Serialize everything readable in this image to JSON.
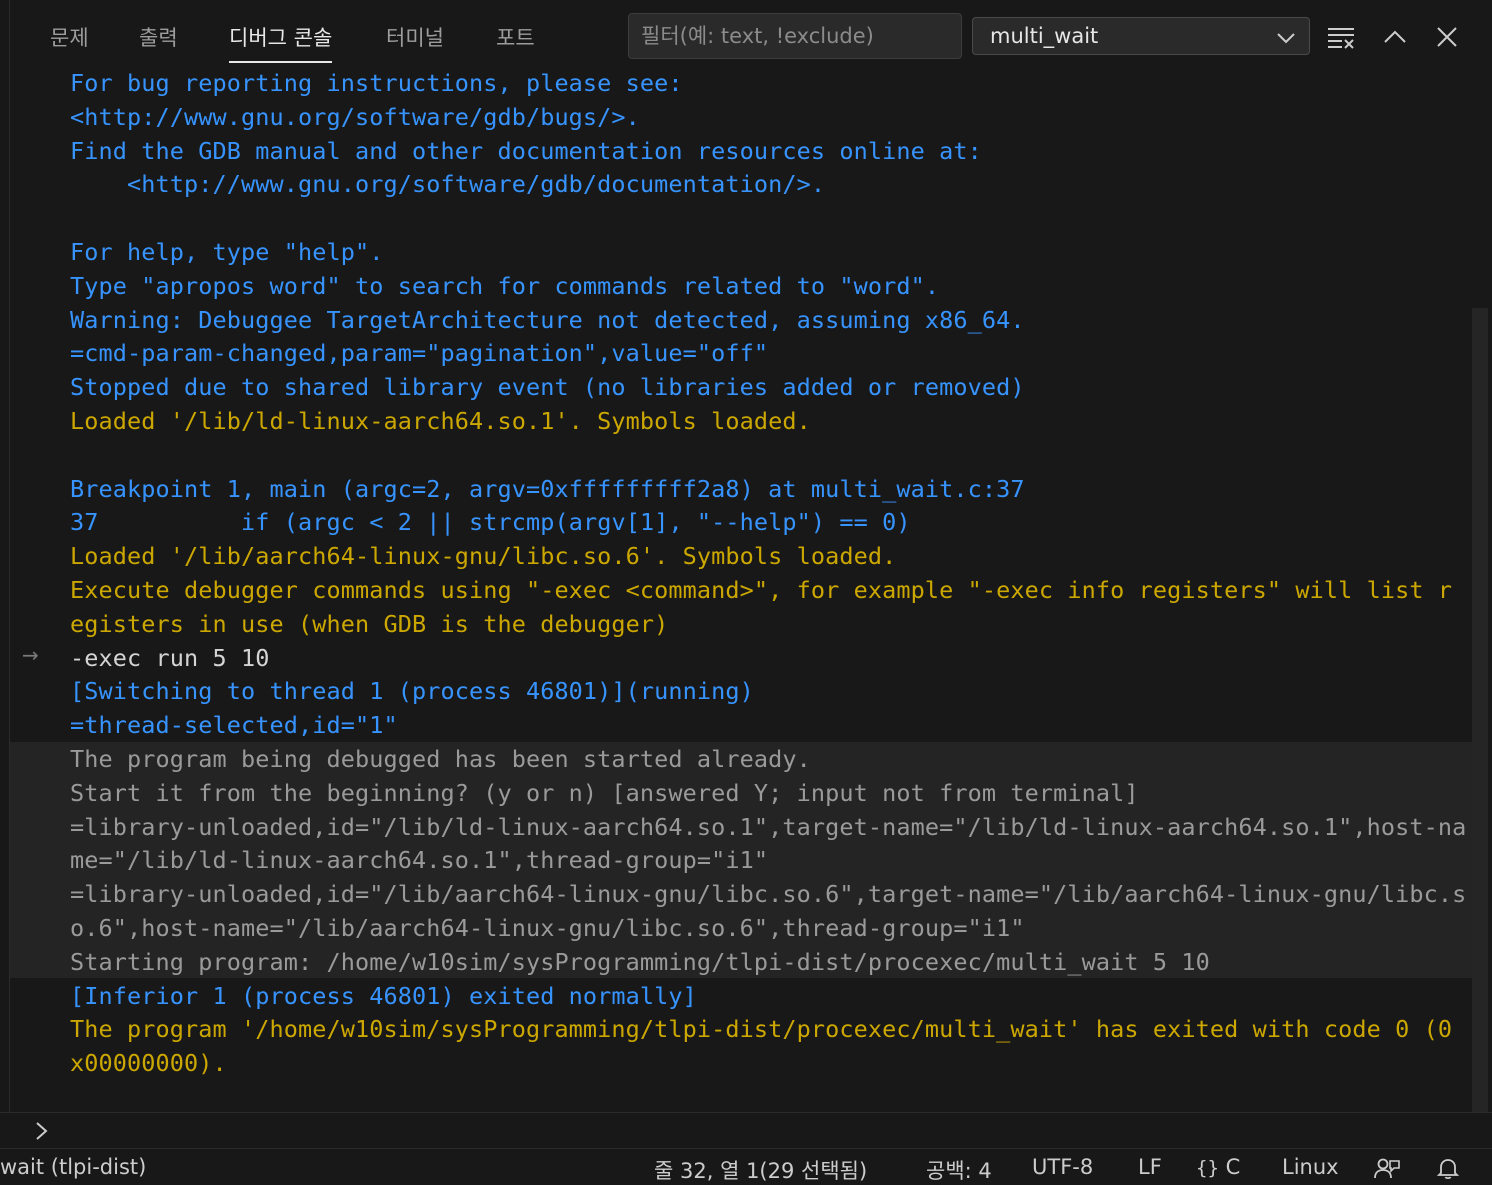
{
  "tabs": [
    {
      "label": "문제"
    },
    {
      "label": "출력"
    },
    {
      "label": "디버그 콘솔"
    },
    {
      "label": "터미널"
    },
    {
      "label": "포트"
    }
  ],
  "filter": {
    "placeholder": "필터(예: text, !exclude)",
    "value": ""
  },
  "session_select": {
    "value": "multi_wait"
  },
  "header_icons": [
    "clear-console-icon",
    "collapse-panel-icon",
    "close-icon"
  ],
  "console_lines": [
    {
      "text": "For bug reporting instructions, please see:",
      "color": "blue"
    },
    {
      "text": "<http://www.gnu.org/software/gdb/bugs/>.",
      "color": "blue"
    },
    {
      "text": "Find the GDB manual and other documentation resources online at:",
      "color": "blue"
    },
    {
      "text": "    <http://www.gnu.org/software/gdb/documentation/>.",
      "color": "blue"
    },
    {
      "text": "",
      "color": "blue"
    },
    {
      "text": "For help, type \"help\".",
      "color": "blue"
    },
    {
      "text": "Type \"apropos word\" to search for commands related to \"word\".",
      "color": "blue"
    },
    {
      "text": "Warning: Debuggee TargetArchitecture not detected, assuming x86_64.",
      "color": "blue"
    },
    {
      "text": "=cmd-param-changed,param=\"pagination\",value=\"off\"",
      "color": "blue"
    },
    {
      "text": "Stopped due to shared library event (no libraries added or removed)",
      "color": "blue"
    },
    {
      "text": "Loaded '/lib/ld-linux-aarch64.so.1'. Symbols loaded.",
      "color": "yellow"
    },
    {
      "text": "",
      "color": "blue"
    },
    {
      "text": "Breakpoint 1, main (argc=2, argv=0xfffffffff2a8) at multi_wait.c:37",
      "color": "blue"
    },
    {
      "text": "37\t    if (argc < 2 || strcmp(argv[1], \"--help\") == 0)",
      "color": "blue"
    },
    {
      "text": "Loaded '/lib/aarch64-linux-gnu/libc.so.6'. Symbols loaded.",
      "color": "yellow"
    },
    {
      "text": "Execute debugger commands using \"-exec <command>\", for example \"-exec info registers\" will list r",
      "color": "yellow"
    },
    {
      "text": "egisters in use (when GDB is the debugger)",
      "color": "yellow"
    },
    {
      "text": "-exec run 5 10",
      "color": "white"
    },
    {
      "text": "[Switching to thread 1 (process 46801)](running)",
      "color": "blue"
    },
    {
      "text": "=thread-selected,id=\"1\"",
      "color": "blue"
    },
    {
      "text": "The program being debugged has been started already.",
      "color": "gray"
    },
    {
      "text": "Start it from the beginning? (y or n) [answered Y; input not from terminal]",
      "color": "gray"
    },
    {
      "text": "=library-unloaded,id=\"/lib/ld-linux-aarch64.so.1\",target-name=\"/lib/ld-linux-aarch64.so.1\",host-na",
      "color": "gray"
    },
    {
      "text": "me=\"/lib/ld-linux-aarch64.so.1\",thread-group=\"i1\"",
      "color": "gray"
    },
    {
      "text": "=library-unloaded,id=\"/lib/aarch64-linux-gnu/libc.so.6\",target-name=\"/lib/aarch64-linux-gnu/libc.s",
      "color": "gray"
    },
    {
      "text": "o.6\",host-name=\"/lib/aarch64-linux-gnu/libc.so.6\",thread-group=\"i1\"",
      "color": "gray"
    },
    {
      "text": "Starting program: /home/w10sim/sysProgramming/tlpi-dist/procexec/multi_wait 5 10",
      "color": "gray"
    },
    {
      "text": "[Inferior 1 (process 46801) exited normally]",
      "color": "blue"
    },
    {
      "text": "The program '/home/w10sim/sysProgramming/tlpi-dist/procexec/multi_wait' has exited with code 0 (0",
      "color": "yellow"
    },
    {
      "text": "x00000000).",
      "color": "yellow"
    }
  ],
  "input_prompt": {
    "symbol": ">",
    "value": ""
  },
  "status_bar": {
    "left": "wait (tlpi-dist)",
    "position": "줄 32, 열 1(29 선택됨)",
    "spaces": "공백: 4",
    "encoding": "UTF-8",
    "eol": "LF",
    "language": "C",
    "platform": "Linux"
  },
  "colors": {
    "blue": "#3794ff",
    "yellow": "#cca700",
    "gray": "#9a9a9a",
    "white": "#d4d4d4",
    "background": "#181818"
  }
}
